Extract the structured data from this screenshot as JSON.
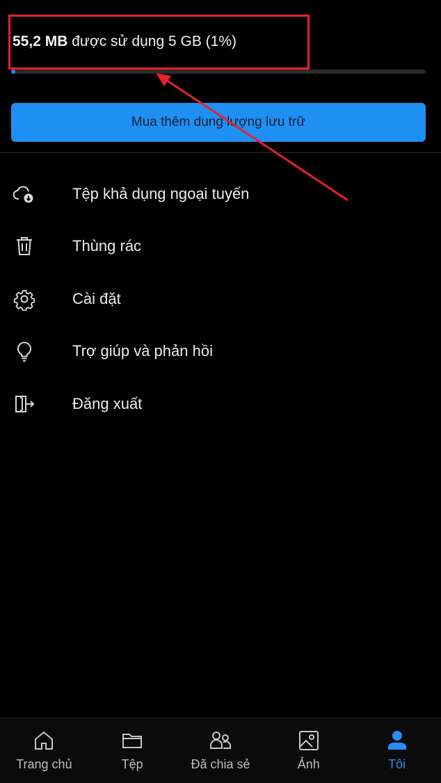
{
  "storage": {
    "used": "55,2 MB",
    "rest": " được sử dụng 5 GB (1%)",
    "percent_used": 1
  },
  "buy_button_label": "Mua thêm dung lượng lưu trữ",
  "menu": {
    "items": [
      {
        "label": "Tệp khả dụng ngoại tuyến",
        "icon": "cloud-offline-icon"
      },
      {
        "label": "Thùng rác",
        "icon": "trash-icon"
      },
      {
        "label": "Cài đặt",
        "icon": "gear-icon"
      },
      {
        "label": "Trợ giúp và phản hồi",
        "icon": "lightbulb-icon"
      },
      {
        "label": "Đăng xuất",
        "icon": "sign-out-icon"
      }
    ]
  },
  "bottom_nav": {
    "items": [
      {
        "label": "Trang chủ",
        "icon": "home-icon"
      },
      {
        "label": "Tệp",
        "icon": "folder-icon"
      },
      {
        "label": "Đã chia sẻ",
        "icon": "people-icon"
      },
      {
        "label": "Ảnh",
        "icon": "image-icon"
      },
      {
        "label": "Tôi",
        "icon": "person-icon",
        "active": true
      }
    ]
  },
  "colors": {
    "accent": "#2a8bf2",
    "button": "#1f8ff4",
    "annotation": "#e8202a",
    "background": "#000000"
  }
}
